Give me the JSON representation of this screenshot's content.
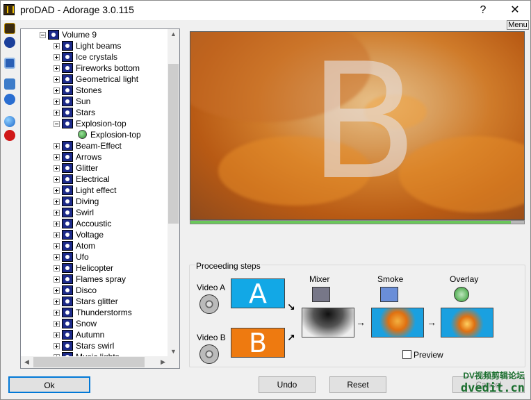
{
  "window": {
    "title": "proDAD - Adorage 3.0.115",
    "help": "?",
    "close": "✕",
    "menu": "Menu"
  },
  "tree": {
    "root": "Volume 9",
    "items": [
      "Light beams",
      "Ice crystals",
      "Fireworks bottom",
      "Geometrical light",
      "Stones",
      "Sun",
      "Stars",
      "Explosion-top",
      "Beam-Effect",
      "Arrows",
      "Glitter",
      "Electrical",
      "Light effect",
      "Diving",
      "Swirl",
      "Accoustic",
      "Voltage",
      "Atom",
      "Ufo",
      "Helicopter",
      "Flames spray",
      "Disco",
      "Stars glitter",
      "Thunderstorms",
      "Snow",
      "Autumn",
      "Stars swirl",
      "Music lights"
    ],
    "expanded_child": "Explosion-top"
  },
  "preview": {
    "letter": "B",
    "progress": 0.96
  },
  "steps": {
    "title": "Proceeding steps",
    "video_a": "Video A",
    "video_b": "Video B",
    "tile_a": "A",
    "tile_b": "B",
    "mixer": "Mixer",
    "smoke": "Smoke",
    "overlay": "Overlay",
    "preview": "Preview"
  },
  "buttons": {
    "ok": "Ok",
    "undo": "Undo",
    "reset": "Reset",
    "cancel": "Cancel"
  },
  "watermark": {
    "line1": "DV视频剪辑论坛",
    "line2": "dvedit.cn"
  },
  "colors": {
    "tile_blue": "#12a8e6",
    "tile_orange": "#ee7a10",
    "progress": "#6ac85a"
  }
}
